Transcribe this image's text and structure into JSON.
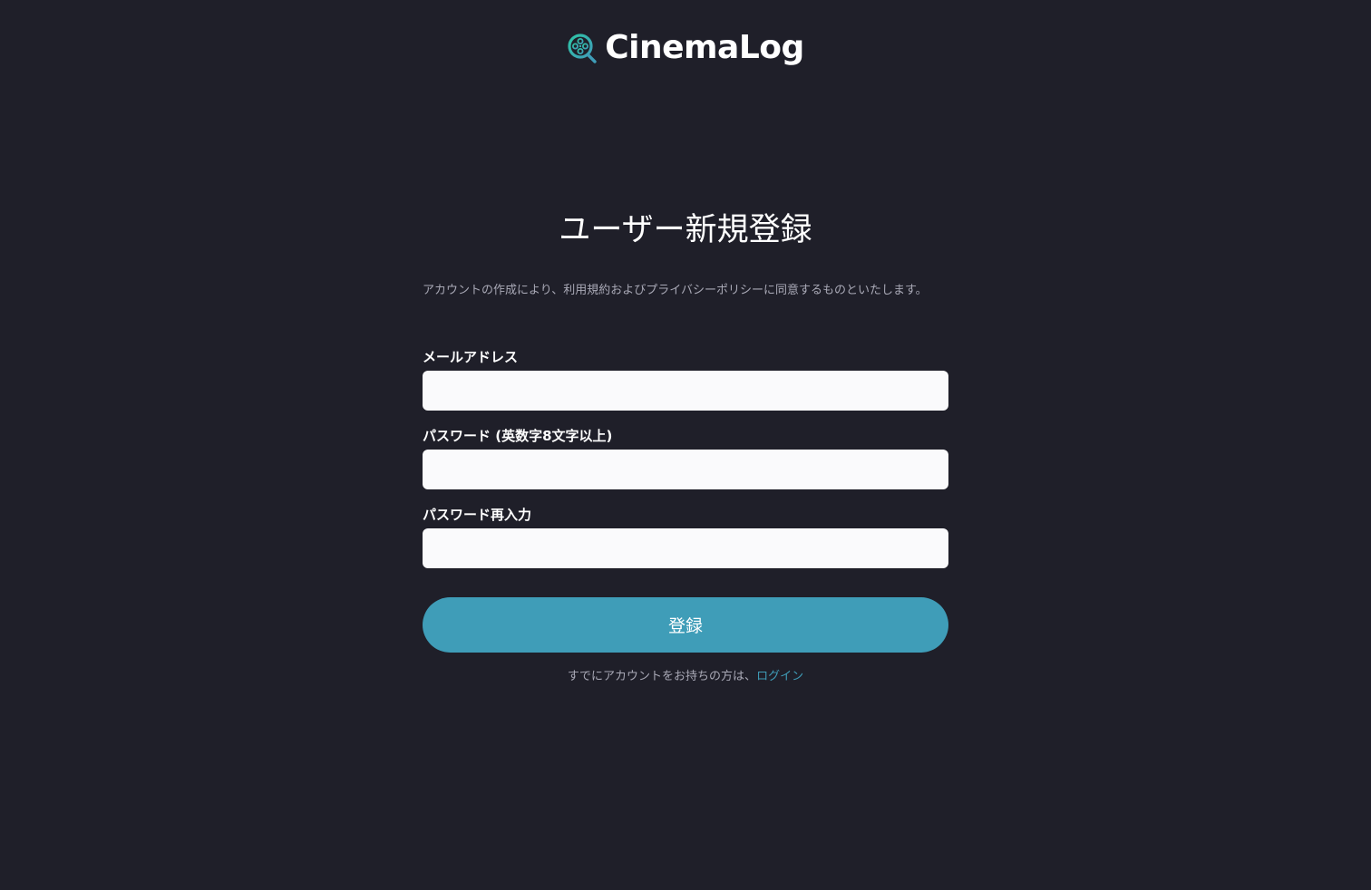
{
  "brand": {
    "name": "CinemaLog",
    "icon": "film-reel-search-icon",
    "icon_colors": [
      "#2ec4a6",
      "#3f9db8"
    ]
  },
  "page": {
    "title": "ユーザー新規登録",
    "terms_notice": "アカウントの作成により、利用規約およびプライバシーポリシーに同意するものといたします。"
  },
  "form": {
    "email": {
      "label": "メールアドレス",
      "value": "",
      "placeholder": ""
    },
    "password": {
      "label": "パスワード (英数字8文字以上)",
      "value": "",
      "placeholder": ""
    },
    "password_confirm": {
      "label": "パスワード再入力",
      "value": "",
      "placeholder": ""
    },
    "submit_label": "登録"
  },
  "login_prompt": {
    "text": "すでにアカウントをお持ちの方は、",
    "link_label": "ログイン"
  },
  "colors": {
    "background": "#1f1f29",
    "accent": "#3f9db8",
    "input_bg": "#fafafc",
    "muted_text": "#a9a9b6"
  }
}
